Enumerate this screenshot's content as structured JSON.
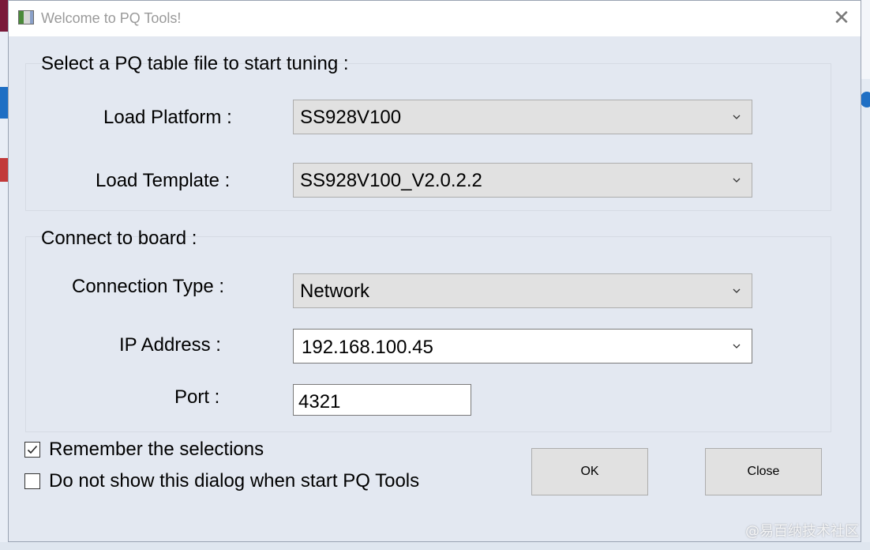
{
  "window": {
    "title": "Welcome to PQ Tools!",
    "close_glyph": "✕"
  },
  "pq_section": {
    "title": "Select a PQ table file to start tuning :",
    "platform_label": "Load Platform :",
    "platform_value": "SS928V100",
    "template_label": "Load Template :",
    "template_value": "SS928V100_V2.0.2.2"
  },
  "board_section": {
    "title": "Connect to board :",
    "connection_type_label": "Connection Type :",
    "connection_type_value": "Network",
    "ip_label": "IP Address :",
    "ip_value": "192.168.100.45",
    "port_label": "Port :",
    "port_value": "4321"
  },
  "options": {
    "remember_label": "Remember the selections",
    "remember_checked": true,
    "dont_show_label": "Do not show this dialog when start PQ Tools",
    "dont_show_checked": false
  },
  "buttons": {
    "ok_label": "OK",
    "close_label": "Close"
  },
  "watermark": "@易百纳技术社区",
  "colors": {
    "dialog_bg": "#e3e8f1",
    "combo_bg": "#e1e1e1",
    "title_text": "#9a9a9a"
  }
}
